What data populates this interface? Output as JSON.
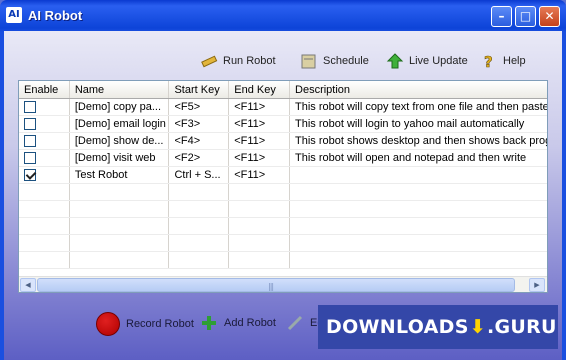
{
  "window": {
    "title": "AI Robot",
    "icon_text": "AI"
  },
  "toolbar": {
    "run_robot": "Run Robot",
    "schedule": "Schedule",
    "live_update": "Live Update",
    "help": "Help"
  },
  "grid": {
    "columns": [
      "Enable",
      "Name",
      "Start Key",
      "End Key",
      "Description"
    ],
    "rows": [
      {
        "enabled": false,
        "name": "[Demo] copy pa...",
        "start": "<F5>",
        "end": "<F11>",
        "desc": "This robot will copy text from one file and then paste i"
      },
      {
        "enabled": false,
        "name": "[Demo] email login",
        "start": "<F3>",
        "end": "<F11>",
        "desc": "This robot will login to yahoo mail automatically"
      },
      {
        "enabled": false,
        "name": "[Demo] show de...",
        "start": "<F4>",
        "end": "<F11>",
        "desc": "This robot shows desktop and then shows back prog"
      },
      {
        "enabled": false,
        "name": "[Demo] visit web",
        "start": "<F2>",
        "end": "<F11>",
        "desc": "This robot will open and notepad and then write"
      },
      {
        "enabled": true,
        "name": "Test Robot",
        "start": "Ctrl + S...",
        "end": "<F11>",
        "desc": ""
      }
    ]
  },
  "bottom": {
    "record_robot": "Record Robot",
    "add_robot": "Add Robot",
    "edit": "Ed"
  },
  "watermark": {
    "part1": "DOWNLOADS",
    "part2": ".GURU"
  }
}
